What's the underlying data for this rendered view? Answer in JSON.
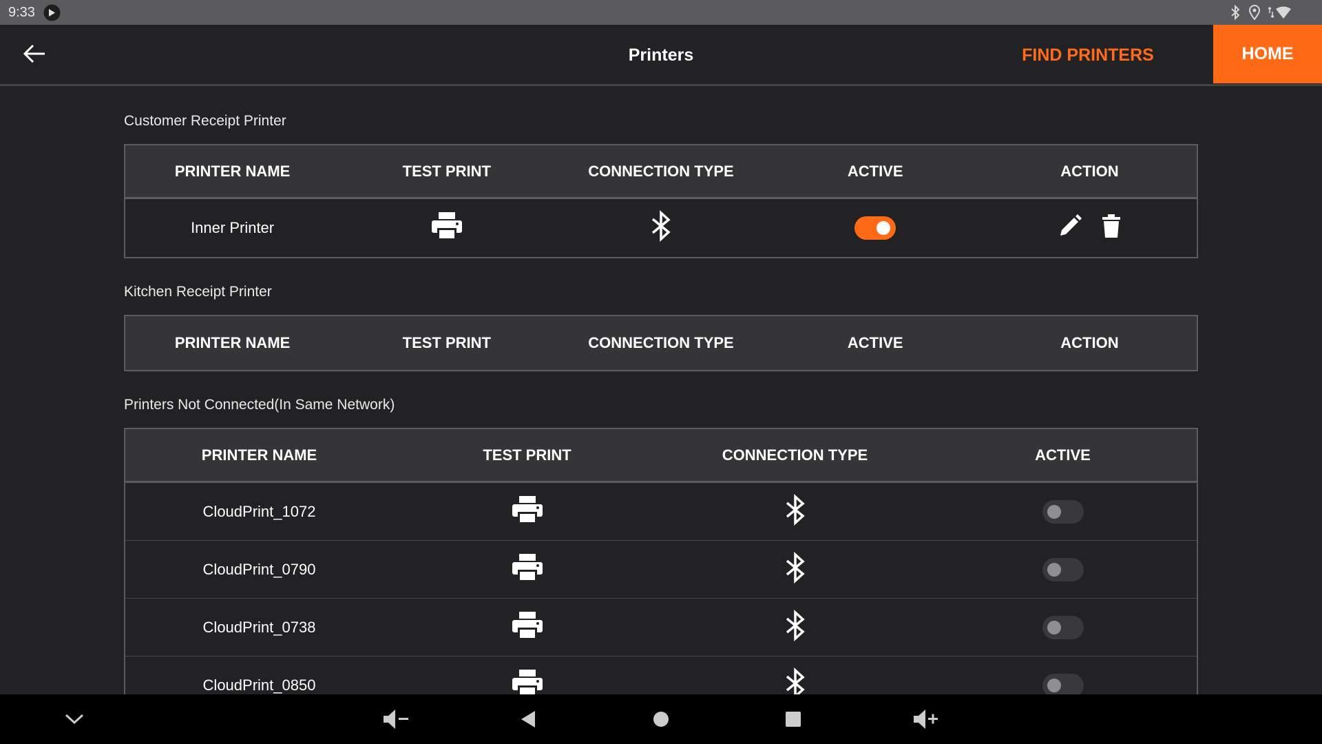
{
  "status_bar": {
    "time": "9:33",
    "icons": [
      "sync-icon",
      "bluetooth-icon",
      "location-icon",
      "wifi-icon"
    ]
  },
  "header": {
    "title": "Printers",
    "find_printers_label": "FIND PRINTERS",
    "home_label": "HOME",
    "accent_color": "#ff6a16"
  },
  "customer_section": {
    "label": "Customer Receipt Printer",
    "columns": [
      "PRINTER NAME",
      "TEST PRINT",
      "CONNECTION TYPE",
      "ACTIVE",
      "ACTION"
    ],
    "rows": [
      {
        "name": "Inner Printer",
        "test_print_icon": "printer-icon",
        "connection_icon": "bluetooth-icon",
        "active": true,
        "actions": [
          "edit-icon",
          "delete-icon"
        ]
      }
    ]
  },
  "kitchen_section": {
    "label": "Kitchen Receipt Printer",
    "columns": [
      "PRINTER NAME",
      "TEST PRINT",
      "CONNECTION TYPE",
      "ACTIVE",
      "ACTION"
    ],
    "rows": []
  },
  "not_connected_section": {
    "label": "Printers Not Connected(In Same Network)",
    "columns": [
      "PRINTER NAME",
      "TEST PRINT",
      "CONNECTION TYPE",
      "ACTIVE"
    ],
    "rows": [
      {
        "name": "CloudPrint_1072",
        "active": false
      },
      {
        "name": "CloudPrint_0790",
        "active": false
      },
      {
        "name": "CloudPrint_0738",
        "active": false
      },
      {
        "name": "CloudPrint_0850",
        "active": false
      }
    ]
  },
  "nav_bar": {
    "buttons": [
      "collapse-icon",
      "volume-down-icon",
      "back-icon",
      "home-icon",
      "recents-icon",
      "volume-up-icon"
    ]
  }
}
